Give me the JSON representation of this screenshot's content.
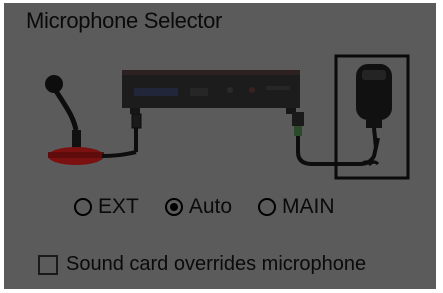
{
  "window": {
    "title": "Microphone Selector"
  },
  "source": {
    "options": [
      {
        "label": "EXT",
        "checked": false
      },
      {
        "label": "Auto",
        "checked": true
      },
      {
        "label": "MAIN",
        "checked": false
      }
    ]
  },
  "override": {
    "label": "Sound card overrides microphone",
    "checked": false
  },
  "colors": {
    "panel_background": "#5b5b5b",
    "desk_mic_base": "#7a1010",
    "radio_body": "#1c1c1c"
  },
  "icons": [
    "desk-microphone-icon",
    "radio-transceiver-icon",
    "hand-microphone-icon"
  ]
}
